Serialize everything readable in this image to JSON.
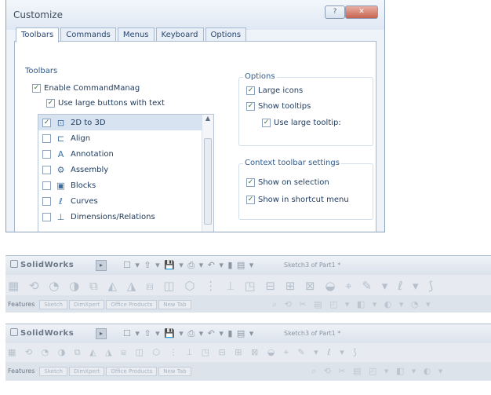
{
  "dialog": {
    "title": "Customize",
    "tabs": [
      "Toolbars",
      "Commands",
      "Menus",
      "Keyboard",
      "Options"
    ],
    "toolbars_group": {
      "label": "Toolbars",
      "enable_cm": "Enable CommandManag",
      "large_buttons": "Use large buttons with text",
      "items": [
        {
          "label": "2D to 3D",
          "icon": "2d-to-3d-icon",
          "glyph": "⊡",
          "checked": true
        },
        {
          "label": "Align",
          "icon": "align-icon",
          "glyph": "⊏",
          "checked": false
        },
        {
          "label": "Annotation",
          "icon": "annotation-icon",
          "glyph": "A",
          "checked": false
        },
        {
          "label": "Assembly",
          "icon": "assembly-icon",
          "glyph": "⚙",
          "checked": false
        },
        {
          "label": "Blocks",
          "icon": "blocks-icon",
          "glyph": "▣",
          "checked": false
        },
        {
          "label": "Curves",
          "icon": "curves-icon",
          "glyph": "ℓ",
          "checked": false
        },
        {
          "label": "Dimensions/Relations",
          "icon": "dimensions-icon",
          "glyph": "⊥",
          "checked": false
        }
      ]
    },
    "options_group": {
      "label": "Options",
      "large_icons": "Large icons",
      "show_tooltips": "Show tooltips",
      "large_tooltips": "Use large tooltip:"
    },
    "context_group": {
      "label": "Context toolbar settings",
      "show_on_selection": "Show on selection",
      "show_in_shortcut": "Show in shortcut menu"
    }
  },
  "toolbar_strips": [
    {
      "app": "SolidWorks",
      "doc_title": "Sketch3 of Part1 *",
      "label": "Features",
      "tabs": [
        "Sketch",
        "DimXpert",
        "Office Products",
        "New Tab"
      ]
    },
    {
      "app": "SolidWorks",
      "doc_title": "Sketch3 of Part1 *",
      "label": "Features",
      "tabs": [
        "Sketch",
        "DimXpert",
        "Office Products",
        "New Tab"
      ]
    }
  ]
}
